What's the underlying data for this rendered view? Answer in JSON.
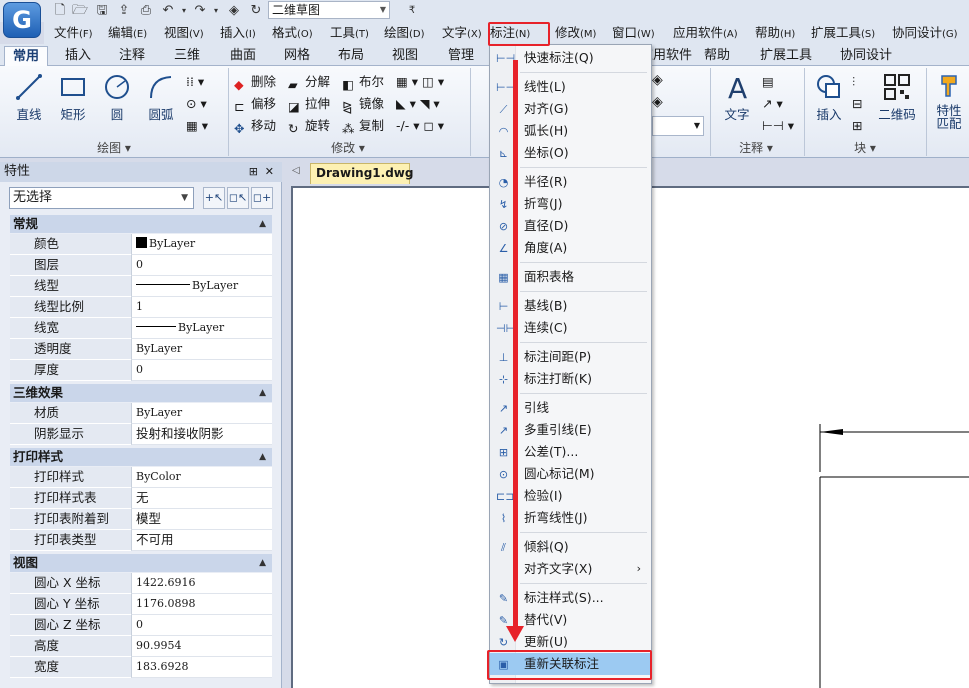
{
  "app": {
    "logo_letter": "G",
    "drawing_name": "二维草图"
  },
  "menubar": [
    {
      "label": "文件",
      "acc": "(F)"
    },
    {
      "label": "编辑",
      "acc": "(E)"
    },
    {
      "label": "视图",
      "acc": "(V)"
    },
    {
      "label": "插入",
      "acc": "(I)"
    },
    {
      "label": "格式",
      "acc": "(O)"
    },
    {
      "label": "工具",
      "acc": "(T)"
    },
    {
      "label": "绘图",
      "acc": "(D)"
    },
    {
      "label": "文字",
      "acc": "(X)"
    },
    {
      "label": "标注",
      "acc": "(N)"
    },
    {
      "label": "修改",
      "acc": "(M)"
    },
    {
      "label": "窗口",
      "acc": "(W)"
    },
    {
      "label": "应用软件",
      "acc": "(A)"
    },
    {
      "label": "帮助",
      "acc": "(H)"
    },
    {
      "label": "扩展工具",
      "acc": "(S)"
    },
    {
      "label": "协同设计",
      "acc": "(G)"
    }
  ],
  "ribbon_tabs": [
    "常用",
    "插入",
    "注释",
    "三维",
    "曲面",
    "网格",
    "布局",
    "视图",
    "管理",
    "应用软件",
    "帮助",
    "扩展工具",
    "协同设计"
  ],
  "ribbon": {
    "draw": {
      "group_label": "绘图",
      "line": "直线",
      "rect": "矩形",
      "circle": "圆",
      "arc": "圆弧"
    },
    "modify": {
      "group_label": "修改",
      "erase": "删除",
      "explode": "分解",
      "boolean": "布尔",
      "offset": "偏移",
      "stretch": "拉伸",
      "mirror": "镜像",
      "move": "移动",
      "rotate": "旋转",
      "copy": "复制"
    },
    "annotate": {
      "group_label": "注释",
      "text": "文字"
    },
    "block": {
      "group_label": "块",
      "insert": "插入",
      "qrcode": "二维码"
    },
    "matchprop": {
      "line1": "特性",
      "line2": "匹配"
    }
  },
  "properties": {
    "title": "特性",
    "selection": "无选择",
    "sections": [
      {
        "title": "常规",
        "rows": [
          {
            "name": "颜色",
            "value": "ByLayer"
          },
          {
            "name": "图层",
            "value": "0"
          },
          {
            "name": "线型",
            "value": "ByLayer"
          },
          {
            "name": "线型比例",
            "value": "1"
          },
          {
            "name": "线宽",
            "value": "ByLayer"
          },
          {
            "name": "透明度",
            "value": "ByLayer"
          },
          {
            "name": "厚度",
            "value": "0"
          }
        ]
      },
      {
        "title": "三维效果",
        "rows": [
          {
            "name": "材质",
            "value": "ByLayer"
          },
          {
            "name": "阴影显示",
            "value": "投射和接收阴影"
          }
        ]
      },
      {
        "title": "打印样式",
        "rows": [
          {
            "name": "打印样式",
            "value": "ByColor"
          },
          {
            "name": "打印样式表",
            "value": "无"
          },
          {
            "name": "打印表附着到",
            "value": "模型"
          },
          {
            "name": "打印表类型",
            "value": "不可用"
          }
        ]
      },
      {
        "title": "视图",
        "rows": [
          {
            "name": "圆心 X 坐标",
            "value": "1422.6916"
          },
          {
            "name": "圆心 Y 坐标",
            "value": "1176.0898"
          },
          {
            "name": "圆心 Z 坐标",
            "value": "0"
          },
          {
            "name": "高度",
            "value": "90.9954"
          },
          {
            "name": "宽度",
            "value": "183.6928"
          }
        ]
      }
    ]
  },
  "document_tab": "Drawing1.dwg",
  "dimension_menu": [
    {
      "label": "快速标注(Q)",
      "icon": "quick-dimension-icon"
    },
    {
      "sep": true
    },
    {
      "label": "线性(L)",
      "icon": "linear-dimension-icon"
    },
    {
      "label": "对齐(G)",
      "icon": "aligned-dimension-icon"
    },
    {
      "label": "弧长(H)",
      "icon": "arc-length-icon"
    },
    {
      "label": "坐标(O)",
      "icon": "ordinate-icon"
    },
    {
      "sep": true
    },
    {
      "label": "半径(R)",
      "icon": "radius-icon"
    },
    {
      "label": "折弯(J)",
      "icon": "jogged-icon"
    },
    {
      "label": "直径(D)",
      "icon": "diameter-icon"
    },
    {
      "label": "角度(A)",
      "icon": "angular-icon"
    },
    {
      "sep": true
    },
    {
      "label": "面积表格",
      "icon": "area-table-icon"
    },
    {
      "sep": true
    },
    {
      "label": "基线(B)",
      "icon": "baseline-icon"
    },
    {
      "label": "连续(C)",
      "icon": "continue-icon"
    },
    {
      "sep": true
    },
    {
      "label": "标注间距(P)",
      "icon": "dim-space-icon"
    },
    {
      "label": "标注打断(K)",
      "icon": "dim-break-icon"
    },
    {
      "sep": true
    },
    {
      "label": "引线",
      "icon": "leader-icon"
    },
    {
      "label": "多重引线(E)",
      "icon": "multileader-icon"
    },
    {
      "label": "公差(T)...",
      "icon": "tolerance-icon"
    },
    {
      "label": "圆心标记(M)",
      "icon": "center-mark-icon"
    },
    {
      "label": "检验(I)",
      "icon": "inspection-icon"
    },
    {
      "label": "折弯线性(J)",
      "icon": "jogged-linear-icon"
    },
    {
      "sep": true
    },
    {
      "label": "倾斜(Q)",
      "icon": "oblique-icon"
    },
    {
      "label": "对齐文字(X)",
      "icon": "",
      "submenu": true
    },
    {
      "sep": true
    },
    {
      "label": "标注样式(S)...",
      "icon": "dim-style-icon"
    },
    {
      "label": "替代(V)",
      "icon": "override-icon"
    },
    {
      "label": "更新(U)",
      "icon": "update-icon"
    },
    {
      "label": "重新关联标注",
      "icon": "reassociate-icon",
      "highlighted": true
    }
  ],
  "colors": {
    "highlight": "#e7222a",
    "hover": "#9ccaf2",
    "accent": "#1e5fb4"
  }
}
